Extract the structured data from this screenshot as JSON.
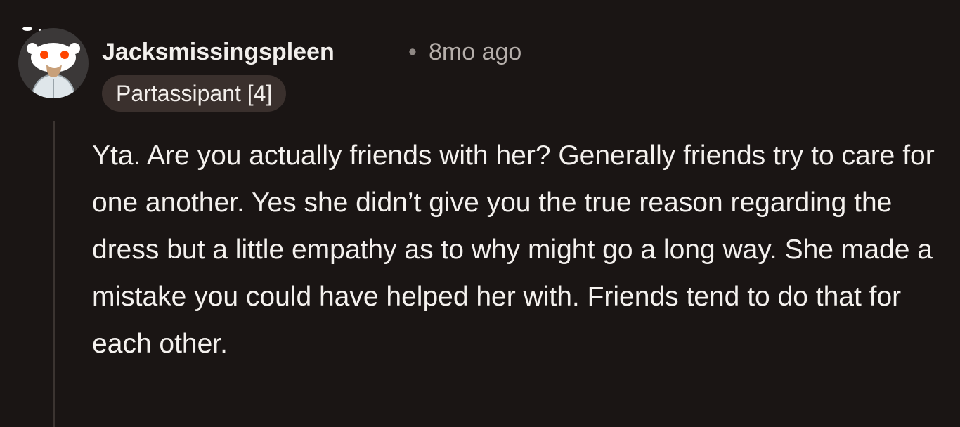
{
  "comment": {
    "author": "Jacksmissingspleen",
    "separator": "•",
    "timestamp": "8mo ago",
    "flair": "Partassipant [4]",
    "body": "Yta. Are you actually friends with her? Generally friends try to care for one another. Yes she didn’t give you the true reason regarding the dress but a little empathy as to why might go a long way. She made a mistake you could have helped her with. Friends tend to do that for each other.",
    "avatar_icon": "snoo-avatar-icon"
  },
  "colors": {
    "background": "#1a1514",
    "text": "#f2eeeb",
    "muted": "#b5aeaa",
    "flair_bg": "#3a302d",
    "thread_line": "#3b3431"
  }
}
